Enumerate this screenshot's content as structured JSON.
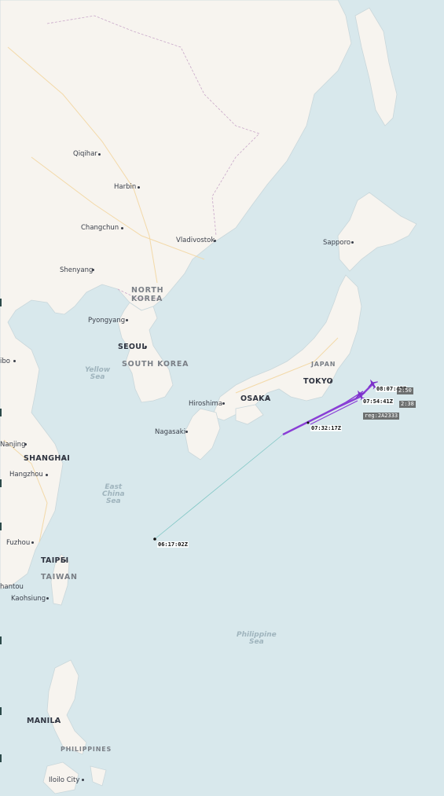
{
  "map": {
    "colors": {
      "water": "#d8e8ec",
      "land": "#f7f4ef",
      "track": "#8a3fd6",
      "track_faint": "#7fc6c4"
    },
    "cities": {
      "qiqihar": "Qiqihar",
      "harbin": "Harbin",
      "changchun": "Changchun",
      "vladivostok": "Vladivostok",
      "shenyang": "Shenyang",
      "pyongyang": "Pyongyang",
      "seoul": "SEOUL",
      "sapporo": "Sapporo",
      "tokyo": "TOKYO",
      "osaka": "OSAKA",
      "hiroshima": "Hiroshima",
      "nagasaki": "Nagasaki",
      "nanjing": "Nanjing",
      "shanghai": "SHANGHAI",
      "hangzhou": "Hangzhou",
      "fuzhou": "Fuzhou",
      "taipei": "TAIPEI",
      "shantou": "hantou",
      "kaohsiung": "Kaohsiung",
      "manila": "MANILA",
      "iloilo": "Iloilo City",
      "beijing_partial": "ibo"
    },
    "countries": {
      "north_korea_1": "NORTH",
      "north_korea_2": "KOREA",
      "south_korea": "SOUTH KOREA",
      "japan": "JAPAN",
      "taiwan": "TAIWAN",
      "philippines": "PHILIPPINES"
    },
    "seas": {
      "yellow_1": "Yellow",
      "yellow_2": "Sea",
      "east_china_1": "East",
      "east_china_2": "China",
      "east_china_3": "Sea",
      "philippine_1": "Philippine",
      "philippine_2": "Sea"
    },
    "flight": {
      "timestamps": [
        "06:17:02Z",
        "07:32:17Z",
        "07:54:41Z",
        "08:07:47Z"
      ],
      "tag_labels": [
        "reg:2A2333",
        "2:38",
        "2:50"
      ],
      "aircraft_icon": "airplane-icon"
    }
  }
}
